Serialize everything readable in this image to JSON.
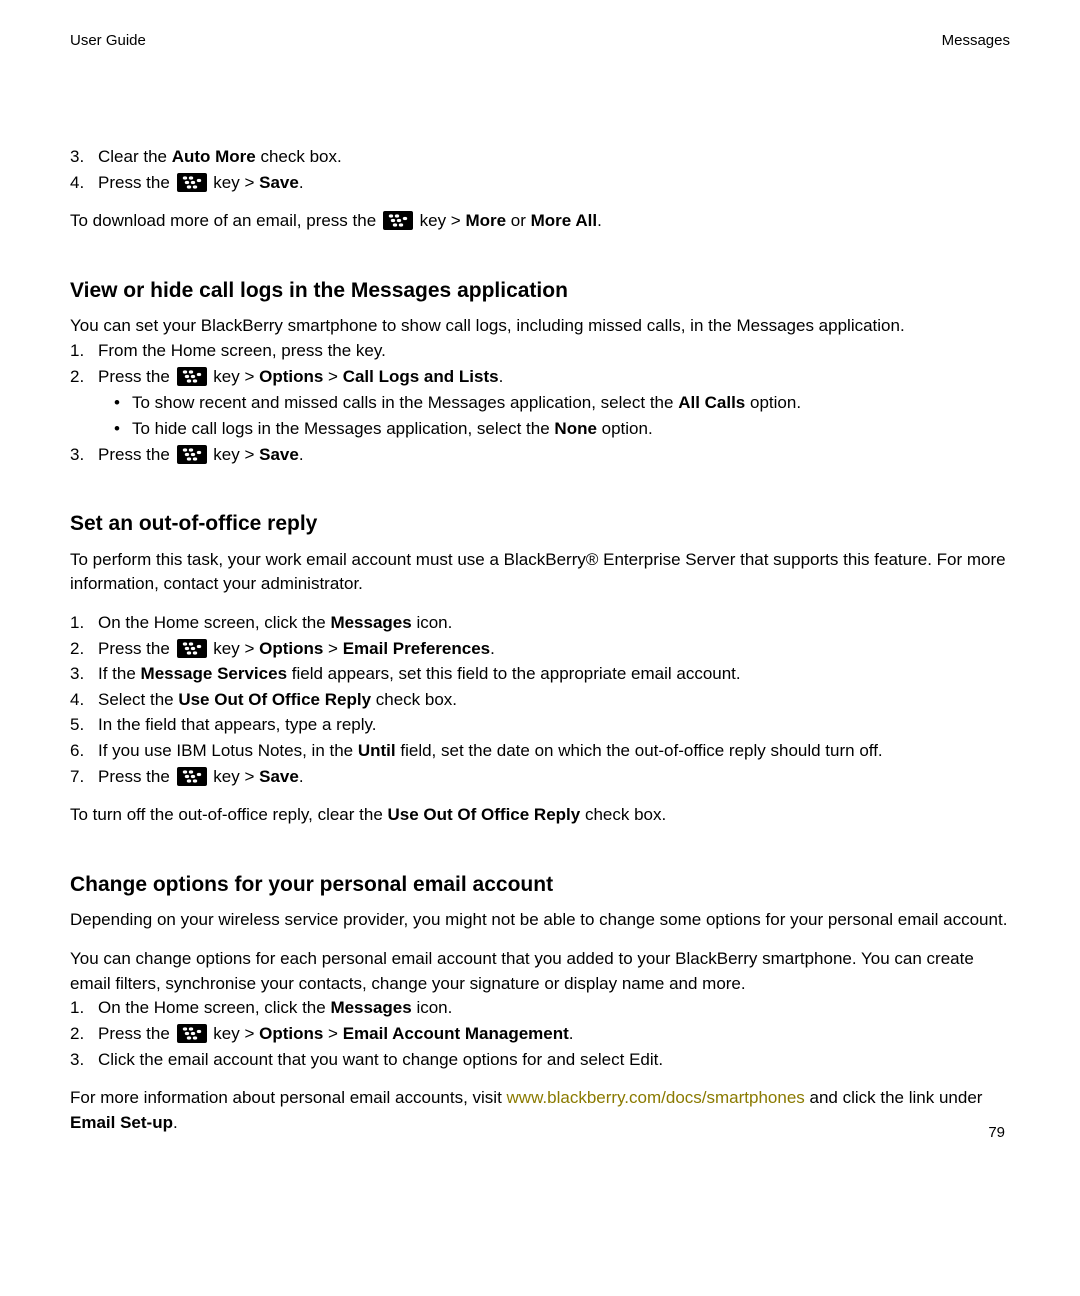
{
  "header": {
    "left": "User Guide",
    "right": "Messages"
  },
  "sec1": {
    "li3_prefix": "Clear the ",
    "li3_b": "Auto More",
    "li3_suffix": " check box.",
    "li4_prefix": "Press the ",
    "li4_mid": " key > ",
    "li4_b": "Save",
    "li4_suffix": ".",
    "dl_prefix": "To download more of an email, press the ",
    "dl_mid": " key > ",
    "dl_b1": "More",
    "dl_or": " or ",
    "dl_b2": "More All",
    "dl_suffix": "."
  },
  "sec2": {
    "heading": "View or hide call logs in the Messages application",
    "intro": "You can set your BlackBerry smartphone to show call logs, including missed calls, in the Messages application.",
    "li1": "From the Home screen, press the key.",
    "li2_prefix": "Press the ",
    "li2_mid1": " key > ",
    "li2_b1": "Options",
    "li2_mid2": " > ",
    "li2_b2": "Call Logs and Lists",
    "li2_suffix": ".",
    "b1_prefix": "To show recent and missed calls in the Messages application, select the ",
    "b1_b": "All Calls",
    "b1_suffix": " option.",
    "b2_prefix": "To hide call logs in the Messages application, select the ",
    "b2_b": "None",
    "b2_suffix": " option.",
    "li3_prefix": "Press the ",
    "li3_mid": " key > ",
    "li3_b": "Save",
    "li3_suffix": "."
  },
  "sec3": {
    "heading": "Set an out-of-office reply",
    "intro": "To perform this task, your work email account must use a BlackBerry® Enterprise Server that supports this feature. For more information, contact your administrator.",
    "li1_prefix": "On the Home screen, click the ",
    "li1_b": "Messages",
    "li1_suffix": " icon.",
    "li2_prefix": "Press the ",
    "li2_mid1": " key > ",
    "li2_b1": "Options",
    "li2_mid2": " > ",
    "li2_b2": "Email Preferences",
    "li2_suffix": ".",
    "li3_prefix": "If the ",
    "li3_b": "Message Services",
    "li3_suffix": " field appears, set this field to the appropriate email account.",
    "li4_prefix": "Select the ",
    "li4_b": "Use Out Of Office Reply",
    "li4_suffix": " check box.",
    "li5": "In the field that appears, type a reply.",
    "li6_prefix": "If you use IBM Lotus Notes, in the ",
    "li6_b": "Until",
    "li6_suffix": " field, set the date on which the out-of-office reply should turn off.",
    "li7_prefix": "Press the ",
    "li7_mid": " key > ",
    "li7_b": "Save",
    "li7_suffix": ".",
    "outro_prefix": "To turn off the out-of-office reply, clear the ",
    "outro_b": "Use Out Of Office Reply",
    "outro_suffix": " check box."
  },
  "sec4": {
    "heading": "Change options for your personal email account",
    "p1": "Depending on your wireless service provider, you might not be able to change some options for your personal email account.",
    "p2": "You can change options for each personal email account that you added to your BlackBerry smartphone. You can create email filters, synchronise your contacts, change your signature or display name and more.",
    "li1_prefix": "On the Home screen, click the ",
    "li1_b": "Messages",
    "li1_suffix": " icon.",
    "li2_prefix": " Press the ",
    "li2_mid1": " key > ",
    "li2_b1": "Options",
    "li2_mid2": " > ",
    "li2_b2": "Email Account Management",
    "li2_suffix": ".",
    "li3": "Click the email account that you want to change options for and select Edit.",
    "outro_prefix": "For more information about personal email accounts, visit ",
    "outro_link": "www.blackberry.com/docs/smartphones",
    "outro_mid": " and click the link under ",
    "outro_b": "Email Set-up",
    "outro_suffix": "."
  },
  "footer": {
    "page": "79"
  }
}
